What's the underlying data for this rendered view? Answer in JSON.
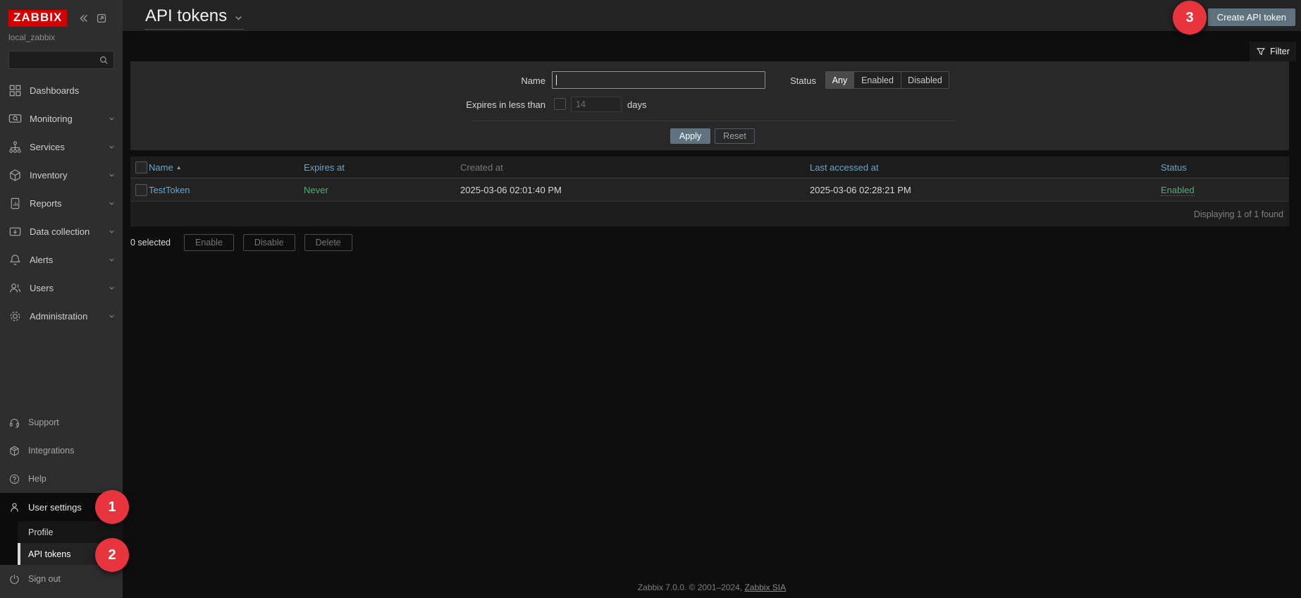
{
  "colors": {
    "logo_red": "#d40000",
    "badge_red": "#e8343c",
    "link_blue": "#63a8cf",
    "status_green": "#4fb070",
    "primary_button": "#5e737f",
    "sidebar_bg": "#2e2e2e",
    "panel_bg": "#282828"
  },
  "annotations": {
    "step1": "1",
    "step2": "2",
    "step3": "3"
  },
  "sidebar": {
    "logo_text": "ZABBIX",
    "server_name": "local_zabbix",
    "menu": [
      {
        "label": "Dashboards",
        "icon": "dashboards-icon"
      },
      {
        "label": "Monitoring",
        "icon": "monitoring-icon"
      },
      {
        "label": "Services",
        "icon": "services-icon"
      },
      {
        "label": "Inventory",
        "icon": "inventory-icon"
      },
      {
        "label": "Reports",
        "icon": "reports-icon"
      },
      {
        "label": "Data collection",
        "icon": "data-collection-icon"
      },
      {
        "label": "Alerts",
        "icon": "alerts-icon"
      },
      {
        "label": "Users",
        "icon": "users-icon"
      },
      {
        "label": "Administration",
        "icon": "administration-icon"
      }
    ],
    "secondary_menu": [
      {
        "label": "Support",
        "icon": "support-icon"
      },
      {
        "label": "Integrations",
        "icon": "integrations-icon"
      },
      {
        "label": "Help",
        "icon": "help-icon"
      }
    ],
    "user_settings_label": "User settings",
    "submenu": {
      "profile": "Profile",
      "api_tokens": "API tokens"
    },
    "sign_out_label": "Sign out"
  },
  "header": {
    "title": "API tokens",
    "create_button_label": "Create API token"
  },
  "filter": {
    "tab_label": "Filter",
    "name_label": "Name",
    "name_value": "",
    "status_label": "Status",
    "status_options": [
      "Any",
      "Enabled",
      "Disabled"
    ],
    "status_selected": "Any",
    "expires_label": "Expires in less than",
    "expires_value": "14",
    "expires_unit": "days",
    "apply_label": "Apply",
    "reset_label": "Reset"
  },
  "table": {
    "headers": {
      "name": "Name",
      "expires_at": "Expires at",
      "created_at": "Created at",
      "last_accessed_at": "Last accessed at",
      "status": "Status"
    },
    "sort_indicator": "▲",
    "rows": [
      {
        "name": "TestToken",
        "expires_at": "Never",
        "created_at": "2025-03-06 02:01:40 PM",
        "last_accessed_at": "2025-03-06 02:28:21 PM",
        "status": "Enabled"
      }
    ],
    "summary": "Displaying 1 of 1 found"
  },
  "actions": {
    "selected_count": "0 selected",
    "enable_label": "Enable",
    "disable_label": "Disable",
    "delete_label": "Delete"
  },
  "footer": {
    "version_text": "Zabbix 7.0.0. © 2001–2024, ",
    "link_text": "Zabbix SIA"
  }
}
